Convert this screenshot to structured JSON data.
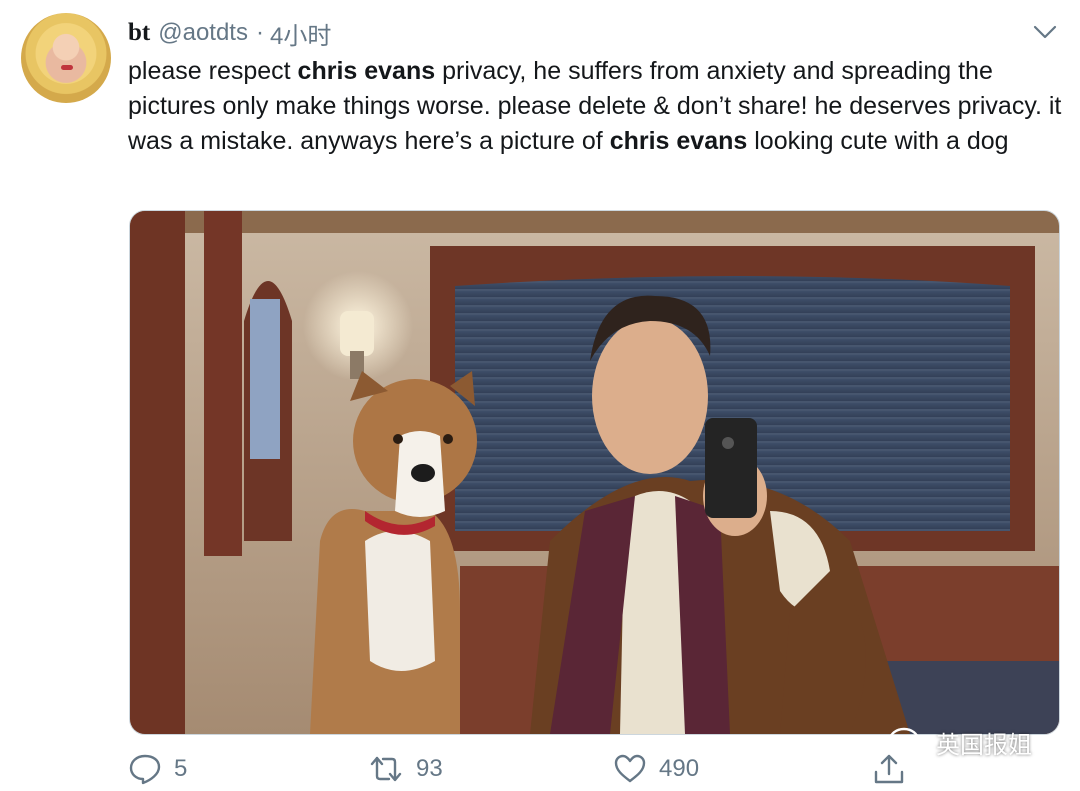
{
  "tweet": {
    "author_name": "bt",
    "handle": "@aotdts",
    "separator": "·",
    "time": "4小时",
    "text_parts": [
      {
        "text": "please respect ",
        "bold": false
      },
      {
        "text": "chris evans",
        "bold": true
      },
      {
        "text": " privacy, he suffers from anxiety and spreading the pictures only make things worse. please delete & don’t share! he deserves privacy. it was a mistake. anyways here’s a picture of ",
        "bold": false
      },
      {
        "text": "chris evans",
        "bold": true
      },
      {
        "text": " looking cute with a dog",
        "bold": false
      }
    ]
  },
  "actions": {
    "replies": "5",
    "retweets": "93",
    "likes": "490"
  },
  "watermark": "英国报姐",
  "icons": {
    "menu": "chevron-down-icon",
    "reply": "reply-icon",
    "retweet": "retweet-icon",
    "like": "heart-icon",
    "share": "share-icon"
  },
  "colors": {
    "text": "#14171a",
    "secondary": "#657786"
  }
}
